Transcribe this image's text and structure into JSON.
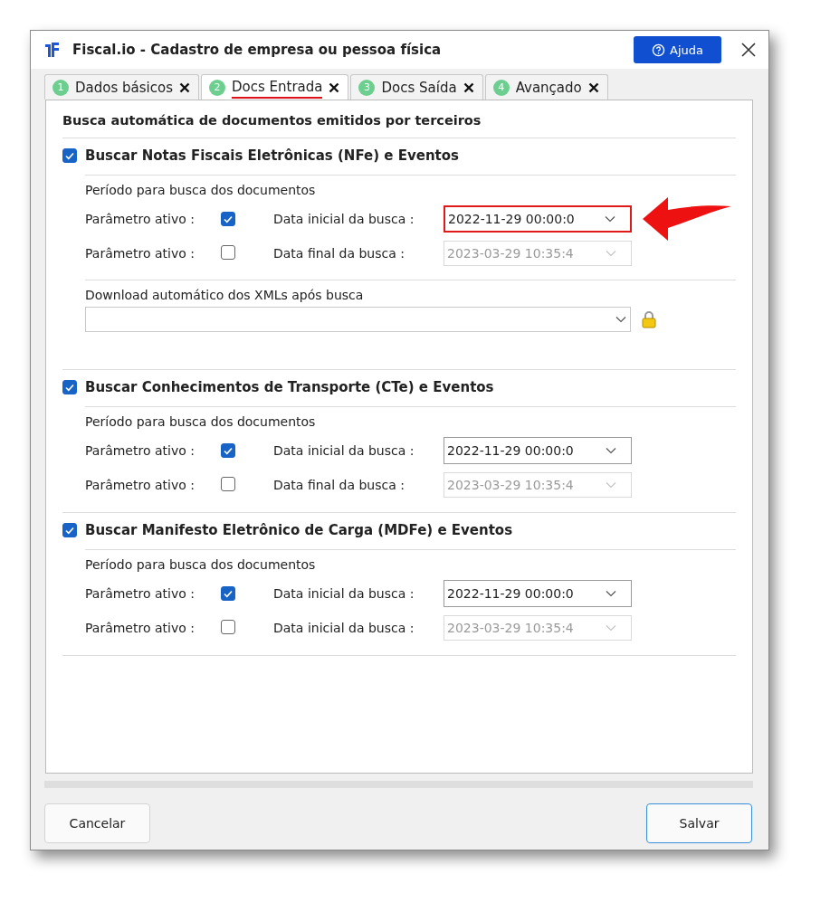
{
  "window": {
    "title": "Fiscal.io - Cadastro de empresa ou pessoa física",
    "help_button": "Ajuda"
  },
  "tabs": [
    {
      "number": "1",
      "label": "Dados básicos",
      "selected": false
    },
    {
      "number": "2",
      "label": "Docs Entrada",
      "selected": true
    },
    {
      "number": "3",
      "label": "Docs Saída",
      "selected": false
    },
    {
      "number": "4",
      "label": "Avançado",
      "selected": false
    }
  ],
  "heading": "Busca automática de documentos emitidos por terceiros",
  "sections": [
    {
      "title": "Buscar Notas Fiscais Eletrônicas (NFe) e Eventos",
      "checked": true,
      "period_label": "Período para busca dos documentos",
      "rows": [
        {
          "param_label": "Parâmetro ativo :",
          "checked": true,
          "date_label": "Data inicial da busca :",
          "value": "2022-11-29 00:00:0",
          "disabled": false,
          "highlighted": true
        },
        {
          "param_label": "Parâmetro ativo :",
          "checked": false,
          "date_label": "Data final da busca :",
          "value": "2023-03-29 10:35:4",
          "disabled": true,
          "highlighted": false
        }
      ],
      "download": {
        "label": "Download automático dos XMLs após busca",
        "locked": true
      }
    },
    {
      "title": "Buscar Conhecimentos de Transporte (CTe) e Eventos",
      "checked": true,
      "period_label": "Período para busca dos documentos",
      "rows": [
        {
          "param_label": "Parâmetro ativo :",
          "checked": true,
          "date_label": "Data inicial da busca :",
          "value": "2022-11-29 00:00:0",
          "disabled": false,
          "highlighted": false
        },
        {
          "param_label": "Parâmetro ativo :",
          "checked": false,
          "date_label": "Data final da busca :",
          "value": "2023-03-29 10:35:4",
          "disabled": true,
          "highlighted": false
        }
      ]
    },
    {
      "title": "Buscar Manifesto Eletrônico de Carga (MDFe) e Eventos",
      "checked": true,
      "period_label": "Período para busca dos documentos",
      "rows": [
        {
          "param_label": "Parâmetro ativo :",
          "checked": true,
          "date_label": "Data inicial da busca :",
          "value": "2022-11-29 00:00:0",
          "disabled": false,
          "highlighted": false
        },
        {
          "param_label": "Parâmetro ativo :",
          "checked": false,
          "date_label": "Data inicial da busca :",
          "value": "2023-03-29 10:35:4",
          "disabled": true,
          "highlighted": false
        }
      ]
    }
  ],
  "buttons": {
    "cancel": "Cancelar",
    "save": "Salvar"
  }
}
